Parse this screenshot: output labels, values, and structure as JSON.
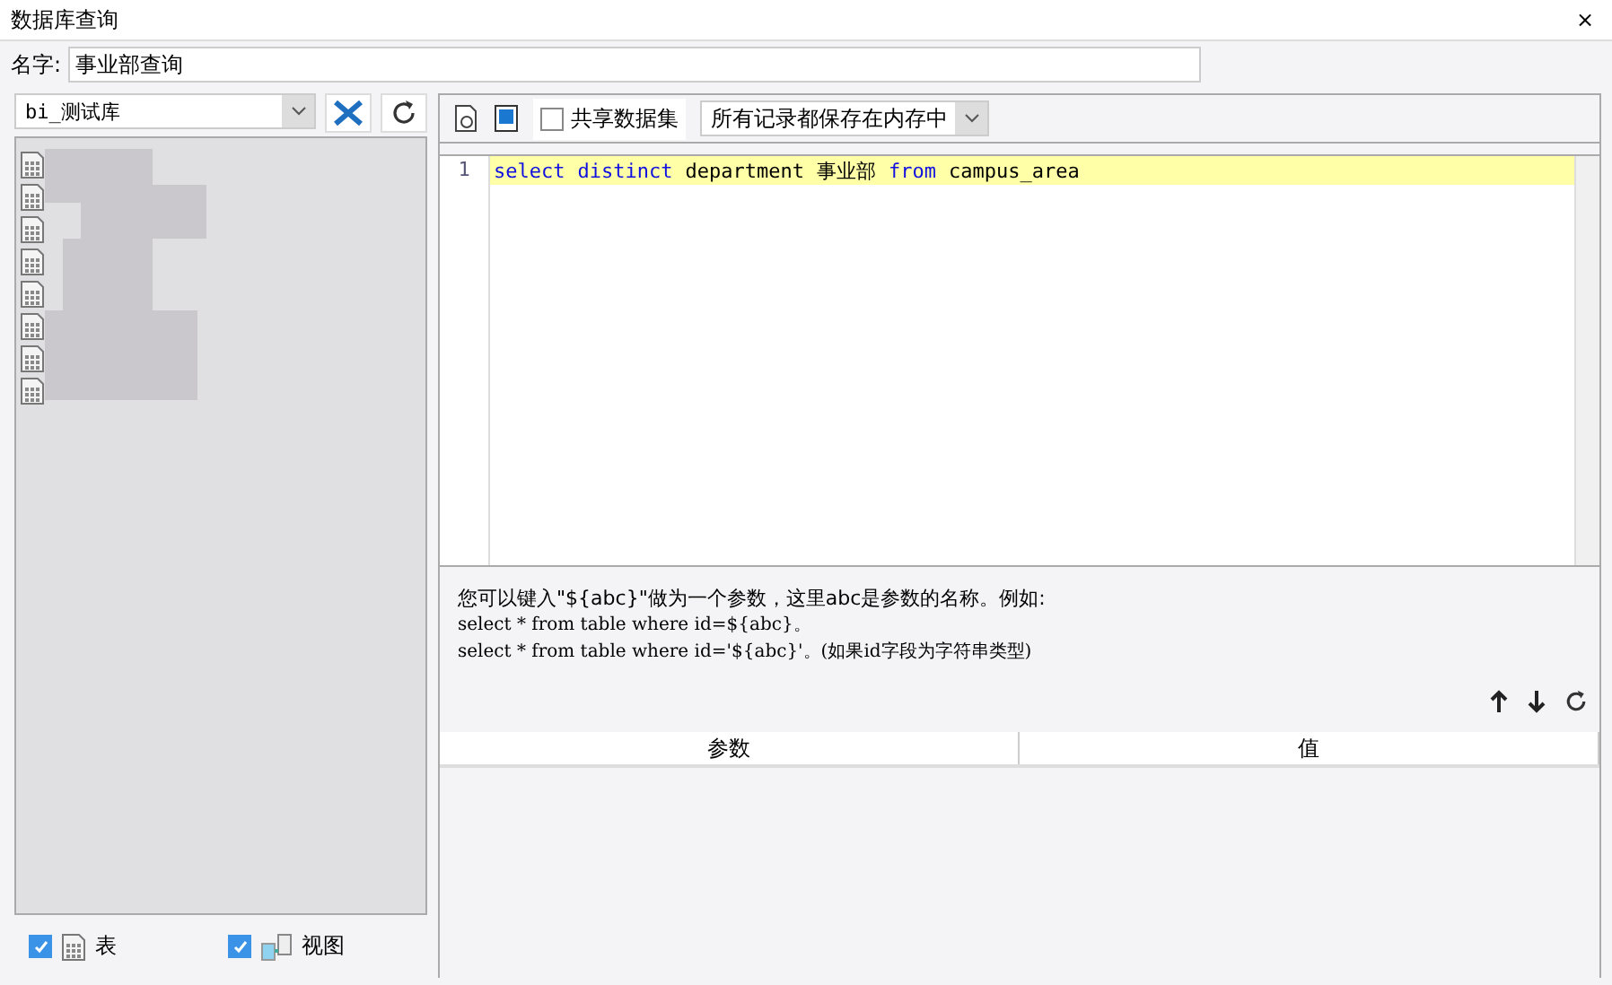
{
  "window": {
    "title": "数据库查询",
    "close": "×"
  },
  "name_field": {
    "label": "名字:",
    "value": "事业部查询"
  },
  "database_select": {
    "value": "bi_测试库"
  },
  "tables": [
    {
      "kind": "table"
    },
    {
      "kind": "table"
    },
    {
      "kind": "table"
    },
    {
      "kind": "table"
    },
    {
      "kind": "table"
    },
    {
      "kind": "table"
    },
    {
      "kind": "table"
    },
    {
      "kind": "table"
    }
  ],
  "filters": [
    {
      "kind": "table",
      "label": "表",
      "checked": true
    },
    {
      "kind": "view",
      "label": "视图",
      "checked": true
    }
  ],
  "toolbar": {
    "share_checkbox": {
      "label": "共享数据集",
      "checked": false
    },
    "cache_select": {
      "value": "所有记录都保存在内存中"
    }
  },
  "editor": {
    "lines": [
      {
        "number": "1",
        "tokens": [
          {
            "kind": "keyword",
            "text": "select"
          },
          {
            "kind": "keyword",
            "text": "distinct"
          },
          {
            "kind": "plain",
            "text": "department"
          },
          {
            "kind": "plain",
            "text": "事业部"
          },
          {
            "kind": "keyword",
            "text": "from"
          },
          {
            "kind": "plain",
            "text": "campus_area"
          }
        ]
      }
    ]
  },
  "help": [
    "您可以键入\"${abc}\"做为一个参数，这里abc是参数的名称。例如:",
    "select * from table where id=${abc}。",
    "select * from table where id='${abc}'。(如果id字段为字符串类型)"
  ],
  "params_table": {
    "columns": [
      "参数",
      "值"
    ]
  }
}
